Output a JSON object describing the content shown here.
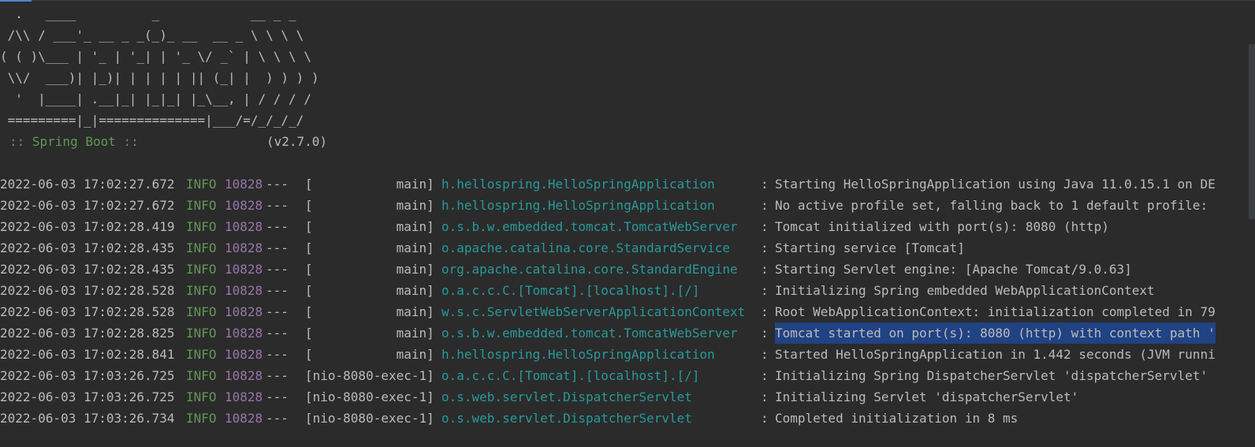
{
  "console": {
    "banner_lines": [
      "  .   ____          _            __ _ _",
      " /\\\\ / ___'_ __ _ _(_)_ __  __ _ \\ \\ \\ \\",
      "( ( )\\___ | '_ | '_| | '_ \\/ _` | \\ \\ \\ \\",
      " \\\\/  ___)| |_)| | | | | || (_| |  ) ) ) )",
      "  '  |____| .__|_| |_|_| |_\\__, | / / / /",
      " =========|_|==============|___/=/_/_/_/"
    ],
    "spring_label": ":: Spring Boot ::",
    "spring_version": "(v2.7.0)",
    "log_lines": [
      {
        "timestamp": "2022-06-03 17:02:27.672",
        "level": "INFO",
        "pid": "10828",
        "separator": "---",
        "thread": "[           main]",
        "logger": "h.hellospring.HelloSpringApplication",
        "message": "Starting HelloSpringApplication using Java 11.0.15.1 on DE"
      },
      {
        "timestamp": "2022-06-03 17:02:27.672",
        "level": "INFO",
        "pid": "10828",
        "separator": "---",
        "thread": "[           main]",
        "logger": "h.hellospring.HelloSpringApplication",
        "message": "No active profile set, falling back to 1 default profile:"
      },
      {
        "timestamp": "2022-06-03 17:02:28.419",
        "level": "INFO",
        "pid": "10828",
        "separator": "---",
        "thread": "[           main]",
        "logger": "o.s.b.w.embedded.tomcat.TomcatWebServer",
        "message": "Tomcat initialized with port(s): 8080 (http)"
      },
      {
        "timestamp": "2022-06-03 17:02:28.435",
        "level": "INFO",
        "pid": "10828",
        "separator": "---",
        "thread": "[           main]",
        "logger": "o.apache.catalina.core.StandardService",
        "message": "Starting service [Tomcat]"
      },
      {
        "timestamp": "2022-06-03 17:02:28.435",
        "level": "INFO",
        "pid": "10828",
        "separator": "---",
        "thread": "[           main]",
        "logger": "org.apache.catalina.core.StandardEngine",
        "message": "Starting Servlet engine: [Apache Tomcat/9.0.63]"
      },
      {
        "timestamp": "2022-06-03 17:02:28.528",
        "level": "INFO",
        "pid": "10828",
        "separator": "---",
        "thread": "[           main]",
        "logger": "o.a.c.c.C.[Tomcat].[localhost].[/]",
        "message": "Initializing Spring embedded WebApplicationContext"
      },
      {
        "timestamp": "2022-06-03 17:02:28.528",
        "level": "INFO",
        "pid": "10828",
        "separator": "---",
        "thread": "[           main]",
        "logger": "w.s.c.ServletWebServerApplicationContext",
        "message": "Root WebApplicationContext: initialization completed in 79"
      },
      {
        "timestamp": "2022-06-03 17:02:28.825",
        "level": "INFO",
        "pid": "10828",
        "separator": "---",
        "thread": "[           main]",
        "logger": "o.s.b.w.embedded.tomcat.TomcatWebServer",
        "message": "Tomcat started on port(s): 8080 (http) with context path '",
        "selected": true
      },
      {
        "timestamp": "2022-06-03 17:02:28.841",
        "level": "INFO",
        "pid": "10828",
        "separator": "---",
        "thread": "[           main]",
        "logger": "h.hellospring.HelloSpringApplication",
        "message": "Started HelloSpringApplication in 1.442 seconds (JVM runni"
      },
      {
        "timestamp": "2022-06-03 17:03:26.725",
        "level": "INFO",
        "pid": "10828",
        "separator": "---",
        "thread": "[nio-8080-exec-1]",
        "logger": "o.a.c.c.C.[Tomcat].[localhost].[/]",
        "message": "Initializing Spring DispatcherServlet 'dispatcherServlet'"
      },
      {
        "timestamp": "2022-06-03 17:03:26.725",
        "level": "INFO",
        "pid": "10828",
        "separator": "---",
        "thread": "[nio-8080-exec-1]",
        "logger": "o.s.web.servlet.DispatcherServlet",
        "message": "Initializing Servlet 'dispatcherServlet'"
      },
      {
        "timestamp": "2022-06-03 17:03:26.734",
        "level": "INFO",
        "pid": "10828",
        "separator": "---",
        "thread": "[nio-8080-exec-1]",
        "logger": "o.s.web.servlet.DispatcherServlet",
        "message": "Completed initialization in 8 ms"
      }
    ]
  },
  "colors": {
    "background": "#2b2b2b",
    "text": "#bbbbbb",
    "info_level": "#629755",
    "pid": "#9876aa",
    "logger": "#299999",
    "selection": "#214283"
  }
}
